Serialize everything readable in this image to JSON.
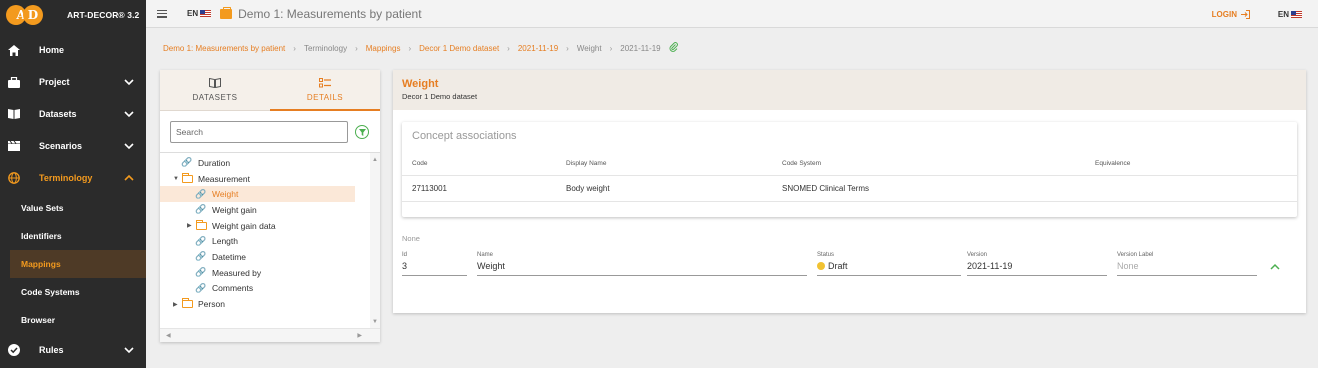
{
  "app": {
    "brand": "ART-DECOR® 3.2",
    "logo_letters": [
      "A",
      "D"
    ],
    "lang": "EN"
  },
  "topbar": {
    "project_title": "Demo 1: Measurements by patient",
    "login_label": "LOGIN",
    "lang": "EN"
  },
  "sidebar": {
    "items": [
      {
        "label": "Home",
        "icon": "home-icon"
      },
      {
        "label": "Project",
        "icon": "briefcase-icon"
      },
      {
        "label": "Datasets",
        "icon": "book-icon"
      },
      {
        "label": "Scenarios",
        "icon": "clapperboard-icon"
      },
      {
        "label": "Terminology",
        "icon": "globe-icon"
      },
      {
        "label": "Rules",
        "icon": "check-circle-icon"
      }
    ],
    "sub_items": [
      "Value Sets",
      "Identifiers",
      "Mappings",
      "Code Systems",
      "Browser"
    ]
  },
  "breadcrumb": [
    "Demo 1: Measurements by patient",
    "Terminology",
    "Mappings",
    "Decor 1 Demo dataset",
    "2021-11-19",
    "Weight",
    "2021-11-19"
  ],
  "left_panel": {
    "tabs": [
      "DATASETS",
      "DETAILS"
    ],
    "search_placeholder": "Search",
    "tree": [
      {
        "label": "Duration",
        "type": "link"
      },
      {
        "label": "Measurement",
        "type": "folder-open"
      },
      {
        "label": "Weight",
        "type": "link"
      },
      {
        "label": "Weight gain",
        "type": "link"
      },
      {
        "label": "Weight gain data",
        "type": "folder"
      },
      {
        "label": "Length",
        "type": "link"
      },
      {
        "label": "Datetime",
        "type": "link"
      },
      {
        "label": "Measured by",
        "type": "link"
      },
      {
        "label": "Comments",
        "type": "link"
      },
      {
        "label": "Person",
        "type": "folder"
      }
    ]
  },
  "detail": {
    "title": "Weight",
    "subtitle": "Decor 1 Demo dataset",
    "card_title": "Concept associations",
    "columns": [
      "Code",
      "Display Name",
      "Code System",
      "Equivalence"
    ],
    "rows": [
      {
        "code": "27113001",
        "display": "Body weight",
        "system": "SNOMED Clinical Terms",
        "equivalence": ""
      }
    ],
    "none_label": "None",
    "fields": {
      "id_label": "Id",
      "id_value": "3",
      "name_label": "Name",
      "name_value": "Weight",
      "status_label": "Status",
      "status_value": "Draft",
      "version_label": "Version",
      "version_value": "2021-11-19",
      "version_label_label": "Version Label",
      "version_label_value": "None"
    }
  },
  "colors": {
    "accent": "#e67e22",
    "sidebar_bg": "#2b2b2b",
    "green": "#4caf50",
    "draft": "#f1c232"
  }
}
